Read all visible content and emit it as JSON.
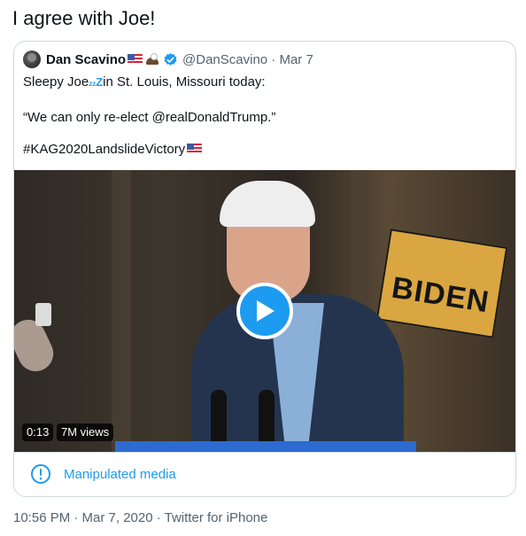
{
  "tweet": {
    "text": "I agree with Joe!",
    "meta": "10:56 PM · Mar 7, 2020 · Twitter for iPhone"
  },
  "quote": {
    "name": "Dan Scavino",
    "handle": "@DanScavino · Mar 7",
    "line1_before": "Sleepy Joe",
    "line1_zz": "zzZ",
    "line1_after": "in St. Louis, Missouri today:",
    "line2": "“We can only re-elect @realDonaldTrump.”",
    "line3": "#KAG2020LandslideVictory",
    "icons": [
      "avatar",
      "us-flag-icon",
      "eagle-icon",
      "verified-icon",
      "play-icon",
      "info-circle-icon"
    ]
  },
  "video": {
    "time": "0:13",
    "views": "7M views",
    "sign_text": "BIDEN"
  },
  "manipulated": {
    "label": "Manipulated media"
  },
  "colors": {
    "accent": "#1d9bf0",
    "border": "#cfd9de",
    "muted": "#536471"
  }
}
